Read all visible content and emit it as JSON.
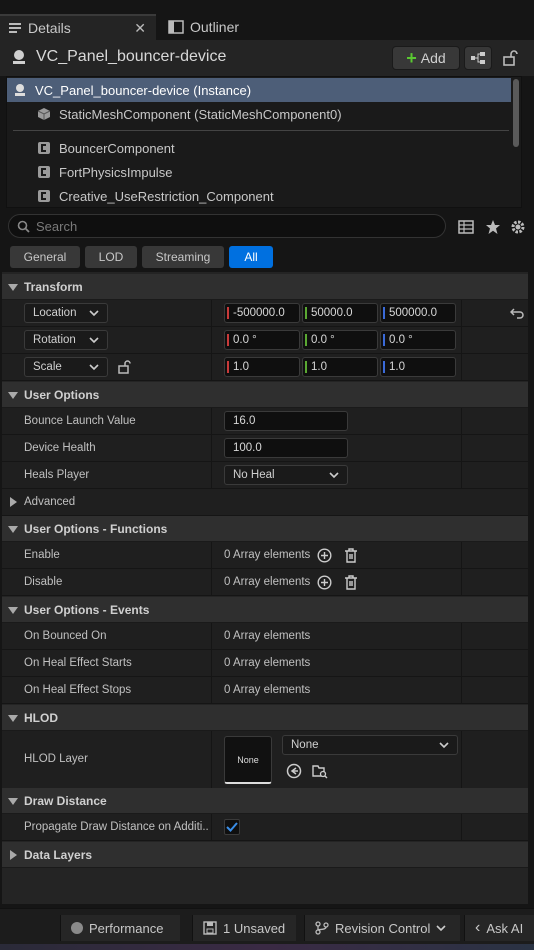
{
  "tabs": [
    {
      "label": "Details",
      "icon": "details-list-icon",
      "active": true
    },
    {
      "label": "Outliner",
      "icon": "outliner-icon",
      "active": false
    }
  ],
  "header": {
    "actor_name": "VC_Panel_bouncer-device",
    "add_label": "Add"
  },
  "tree": {
    "instance": "VC_Panel_bouncer-device (Instance)",
    "mesh": "StaticMeshComponent (StaticMeshComponent0)",
    "components": [
      "BouncerComponent",
      "FortPhysicsImpulse",
      "Creative_UseRestriction_Component"
    ]
  },
  "search": {
    "placeholder": "Search"
  },
  "filters": [
    "General",
    "LOD",
    "Streaming",
    "All"
  ],
  "active_filter": "All",
  "transform": {
    "category": "Transform",
    "location_label": "Location",
    "rotation_label": "Rotation",
    "scale_label": "Scale",
    "location": [
      "-500000.0",
      "50000.0",
      "500000.0"
    ],
    "rotation": [
      "0.0 °",
      "0.0 °",
      "0.0 °"
    ],
    "scale": [
      "1.0",
      "1.0",
      "1.0"
    ]
  },
  "user_options": {
    "category": "User Options",
    "bounce_label": "Bounce Launch Value",
    "bounce_value": "16.0",
    "health_label": "Device Health",
    "health_value": "100.0",
    "heals_label": "Heals Player",
    "heals_value": "No Heal",
    "advanced_label": "Advanced"
  },
  "functions": {
    "category": "User Options - Functions",
    "enable_label": "Enable",
    "disable_label": "Disable",
    "array_text": "0 Array elements"
  },
  "events": {
    "category": "User Options - Events",
    "bounced_label": "On Bounced On",
    "heal_starts_label": "On Heal Effect Starts",
    "heal_stops_label": "On Heal Effect Stops",
    "array_text": "0 Array elements"
  },
  "hlod": {
    "category": "HLOD",
    "layer_label": "HLOD Layer",
    "thumb_text": "None",
    "dropdown_value": "None"
  },
  "draw_distance": {
    "category": "Draw Distance",
    "propagate_label": "Propagate Draw Distance on Additi...",
    "propagate_checked": true
  },
  "data_layers": {
    "category": "Data Layers"
  },
  "statusbar": {
    "performance": "Performance",
    "unsaved": "1 Unsaved",
    "revision": "Revision Control",
    "ask_ai": "Ask AI"
  },
  "colors": {
    "x_axis": "#c83a3a",
    "y_axis": "#5aa832",
    "z_axis": "#3a6ad8",
    "accent": "#0070e0",
    "selection": "#4d5e78"
  }
}
